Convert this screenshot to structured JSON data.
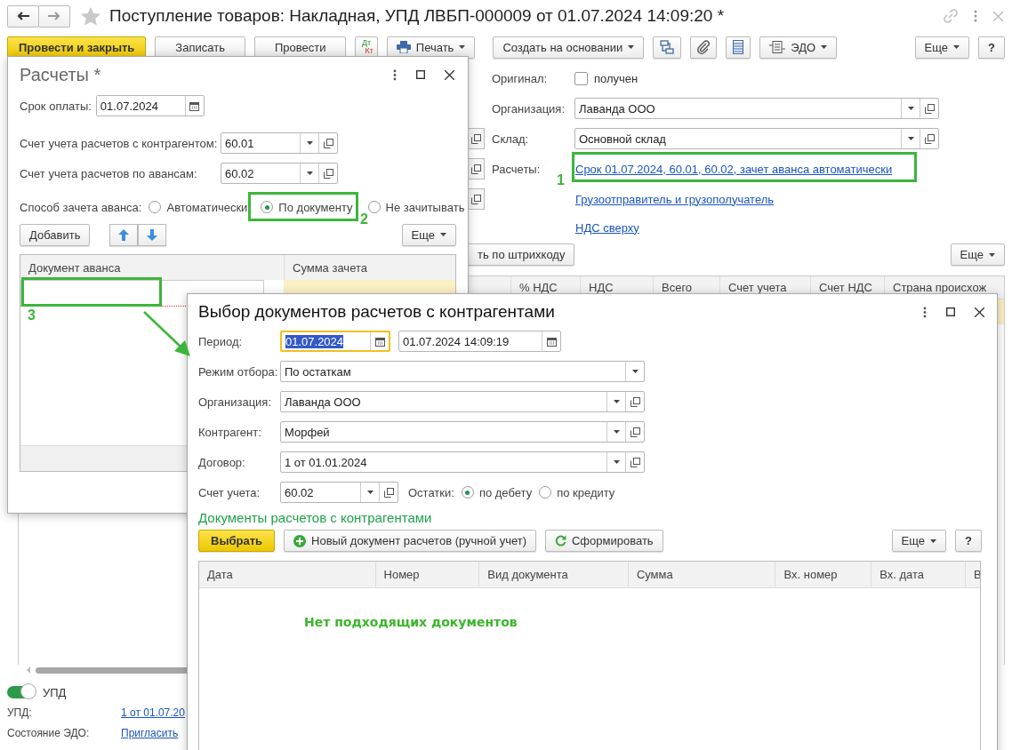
{
  "window": {
    "title": "Поступление товаров: Накладная, УПД ЛВБП-000009 от 01.07.2024 14:09:20 *"
  },
  "toolbar": [
    {
      "kind": "primary",
      "label": "Провести и закрыть"
    },
    {
      "kind": "plain",
      "label": "Записать"
    },
    {
      "kind": "plain",
      "label": "Провести"
    },
    {
      "kind": "dtkt",
      "label": "Дт",
      "label2": "Кт"
    },
    {
      "kind": "print",
      "label": "Печать"
    },
    {
      "kind": "menu",
      "label": "Создать на основании"
    },
    {
      "kind": "structure"
    },
    {
      "kind": "attach"
    },
    {
      "kind": "list"
    },
    {
      "kind": "edo",
      "label": "ЭДО"
    },
    {
      "kind": "more",
      "label": "Еще"
    },
    {
      "kind": "help",
      "label": "?"
    }
  ],
  "original": {
    "label": "Оригинал:",
    "option": "получен",
    "checked": false
  },
  "fields": [
    {
      "label": "Организация:",
      "value": "Лаванда ООО"
    },
    {
      "label": "Склад:",
      "value": "Основной склад"
    }
  ],
  "payments": {
    "label": "Расчеты:",
    "link": "Срок 01.07.2024, 60.01, 60.02, зачет аванса автоматически"
  },
  "links": [
    "Грузоотправитель и грузополучатель",
    "НДС сверху"
  ],
  "goods": {
    "barcode_button": "ть по штрихкоду",
    "more": "Еще",
    "columns": [
      "% НДС",
      "НДС",
      "Всего",
      "Счет учета",
      "Счет НДС",
      "Страна происхож"
    ]
  },
  "footer": {
    "upd_switch": {
      "label": "УПД",
      "on": true
    },
    "rows": [
      {
        "label": "УПД:",
        "link": "1 от 01.07.20"
      },
      {
        "label": "Состояние ЭДО:",
        "link": "Пригласить"
      }
    ]
  },
  "payments_dialog": {
    "title": "Расчеты *",
    "due": {
      "label": "Срок оплаты:",
      "value": "01.07.2024"
    },
    "accounts": [
      {
        "label": "Счет учета расчетов с контрагентом:",
        "value": "60.01"
      },
      {
        "label": "Счет учета расчетов по авансам:",
        "value": "60.02"
      }
    ],
    "advance": {
      "label": "Способ зачета аванса:",
      "options": [
        {
          "label": "Автоматически",
          "selected": false
        },
        {
          "label": "По документу",
          "selected": true
        },
        {
          "label": "Не зачитывать",
          "selected": false
        }
      ]
    },
    "add": "Добавить",
    "more": "Еще",
    "columns": [
      "Документ аванса",
      "Сумма зачета"
    ]
  },
  "selection_dialog": {
    "title": "Выбор документов расчетов с контрагентами",
    "period": {
      "label": "Период:",
      "from": "01.07.2024",
      "to": "01.07.2024 14:09:19"
    },
    "fields": [
      {
        "kind": "select",
        "label": "Режим отбора:",
        "value": "По остаткам"
      },
      {
        "kind": "ref",
        "label": "Организация:",
        "value": "Лаванда ООО"
      },
      {
        "kind": "ref",
        "label": "Контрагент:",
        "value": "Морфей"
      },
      {
        "kind": "ref",
        "label": "Договор:",
        "value": "1 от 01.01.2024"
      }
    ],
    "account": {
      "label": "Счет учета:",
      "value": "60.02"
    },
    "balances": {
      "label": "Остатки:",
      "options": [
        {
          "label": "по дебету",
          "selected": true
        },
        {
          "label": "по кредиту",
          "selected": false
        }
      ]
    },
    "section_title": "Документы расчетов с контрагентами",
    "select": "Выбрать",
    "new_document": "Новый документ расчетов (ручной учет)",
    "refresh": "Сформировать",
    "more": "Еще",
    "help": "?",
    "columns": [
      "Дата",
      "Номер",
      "Вид документа",
      "Сумма",
      "Вх. номер",
      "Вх. дата",
      "В"
    ],
    "empty": "Нет подходящих документов"
  },
  "annotations": [
    {
      "number": "1"
    },
    {
      "number": "2"
    },
    {
      "number": "3"
    }
  ]
}
